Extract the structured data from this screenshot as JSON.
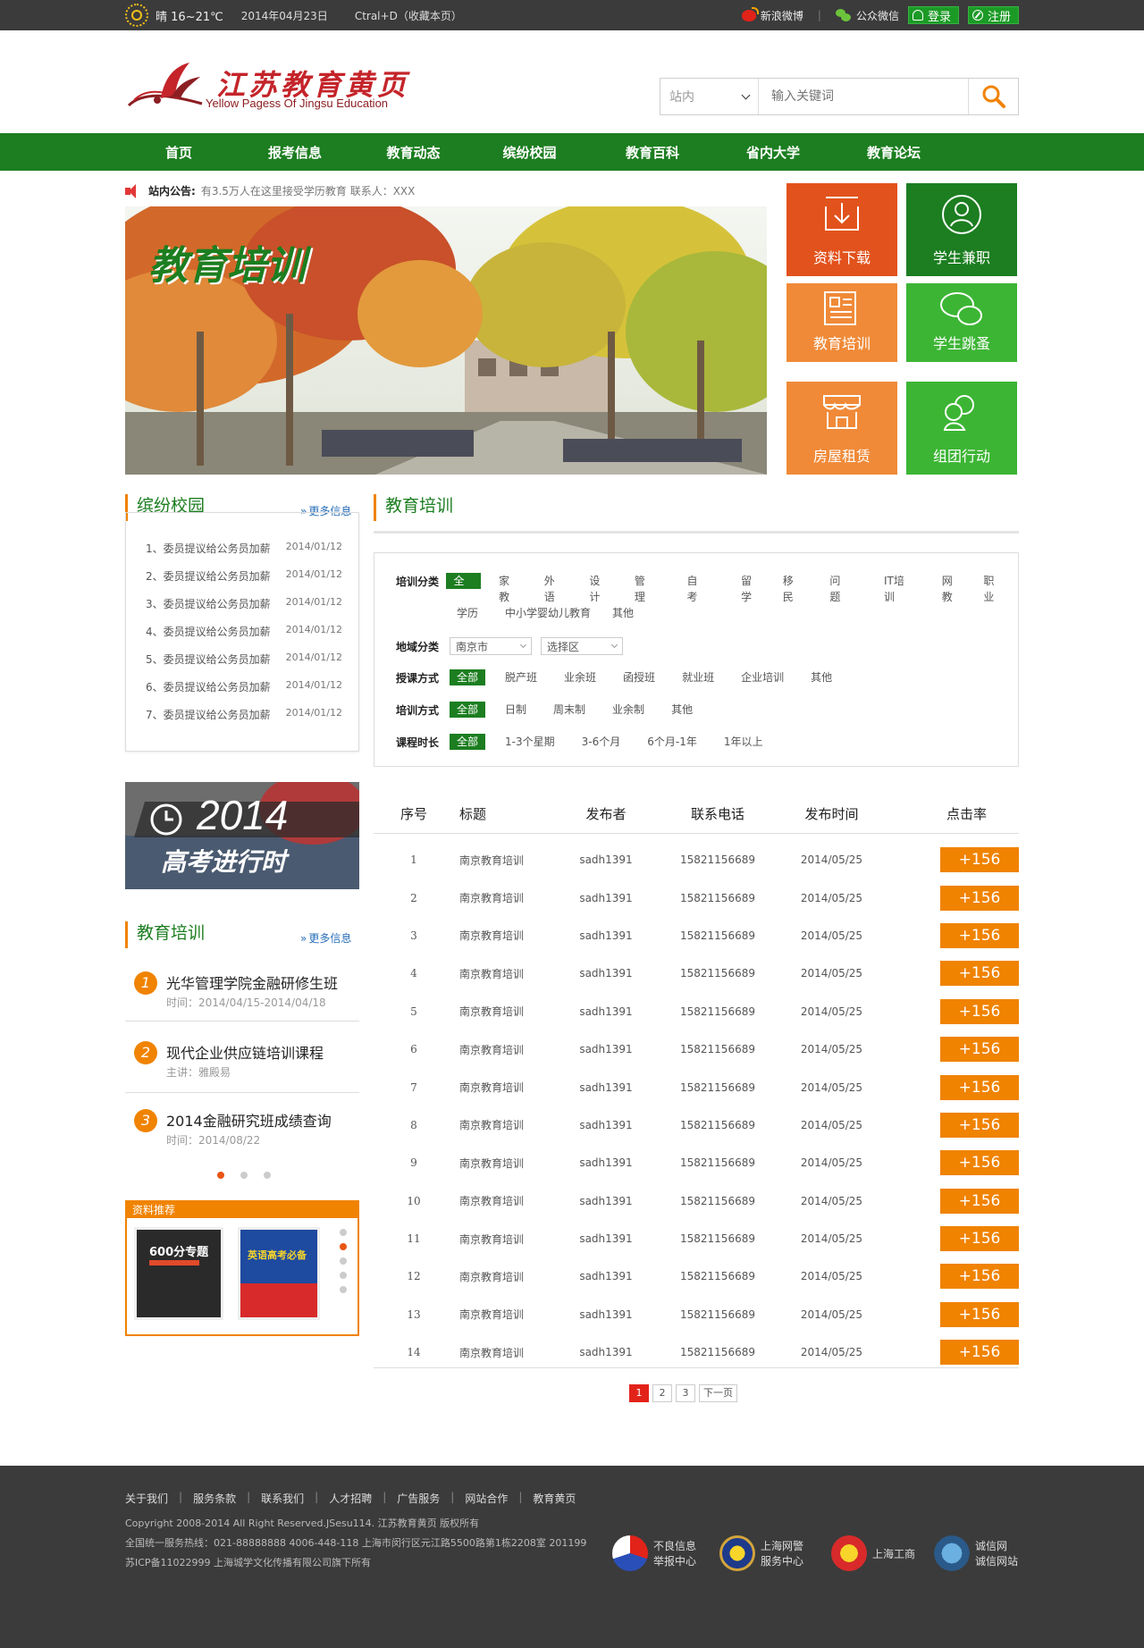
{
  "topbar": {
    "weather": "晴 16~21℃",
    "date": "2014年04月23日",
    "bookmark": "Ctral+D（收藏本页）",
    "weibo": "新浪微博",
    "wechat": "公众微信",
    "login": "登录",
    "register": "注册"
  },
  "logo": {
    "cn": "江苏教育黄页",
    "en": "Yellow Pagess Of Jingsu Education"
  },
  "search": {
    "scope": "站内",
    "placeholder": "输入关键词"
  },
  "nav": [
    "首页",
    "报考信息",
    "教育动态",
    "缤纷校园",
    "教育百科",
    "省内大学",
    "教育论坛"
  ],
  "notice": {
    "label": "站内公告:",
    "text": "有3.5万人在这里接受学历教育   联系人：XXX"
  },
  "banner": {
    "title": "教育培训"
  },
  "tiles": [
    {
      "label": "资料下载",
      "icon": "download-icon",
      "color": "#e2521c"
    },
    {
      "label": "学生兼职",
      "icon": "user-icon",
      "color": "#1c7e20"
    },
    {
      "label": "教育培训",
      "icon": "document-icon",
      "color": "#f08a38"
    },
    {
      "label": "学生跳蚤",
      "icon": "chat-icon",
      "color": "#3cb534"
    },
    {
      "label": "房屋租赁",
      "icon": "shop-icon",
      "color": "#f08a38"
    },
    {
      "label": "组团行动",
      "icon": "group-icon",
      "color": "#3cb534"
    }
  ],
  "campus": {
    "title": "缤纷校园",
    "more": "更多信息",
    "items": [
      {
        "text": "1、委员提议给公务员加薪",
        "date": "2014/01/12"
      },
      {
        "text": "2、委员提议给公务员加薪",
        "date": "2014/01/12"
      },
      {
        "text": "3、委员提议给公务员加薪",
        "date": "2014/01/12"
      },
      {
        "text": "4、委员提议给公务员加薪",
        "date": "2014/01/12"
      },
      {
        "text": "5、委员提议给公务员加薪",
        "date": "2014/01/12"
      },
      {
        "text": "6、委员提议给公务员加薪",
        "date": "2014/01/12"
      },
      {
        "text": "7、委员提议给公务员加薪",
        "date": "2014/01/12"
      }
    ]
  },
  "gaokao": {
    "year": "2014",
    "text": "高考进行时"
  },
  "training_side": {
    "title": "教育培训",
    "more": "更多信息",
    "items": [
      {
        "num": "1",
        "title": "光华管理学院金融研修生班",
        "sub": "时间：2014/04/15-2014/04/18"
      },
      {
        "num": "2",
        "title": "现代企业供应链培训课程",
        "sub": "主讲：雅殿易"
      },
      {
        "num": "3",
        "title": "2014金融研究班成绩查询",
        "sub": "时间：2014/08/22"
      }
    ]
  },
  "books": {
    "title": "资料推荐",
    "book1": "600分专题",
    "book2": "英语高考必备"
  },
  "training_main": {
    "title": "教育培训"
  },
  "filters": {
    "category_label": "培训分类",
    "category_opts": [
      "全部",
      "家教",
      "外语",
      "设计",
      "管理",
      "自考",
      "留学",
      "移民",
      "问题",
      "IT培训",
      "网教",
      "职业"
    ],
    "category_opts2": [
      "学历",
      "中小学婴幼儿教育",
      "其他"
    ],
    "region_label": "地域分类",
    "region_city": "南京市",
    "region_district": "选择区",
    "teach_label": "授课方式",
    "teach_opts": [
      "全部",
      "脱产班",
      "业余班",
      "函授班",
      "就业班",
      "企业培训",
      "其他"
    ],
    "mode_label": "培训方式",
    "mode_opts": [
      "全部",
      "日制",
      "周末制",
      "业余制",
      "其他"
    ],
    "duration_label": "课程时长",
    "duration_opts": [
      "全部",
      "1-3个星期",
      "3-6个月",
      "6个月-1年",
      "1年以上"
    ]
  },
  "table": {
    "headers": [
      "序号",
      "标题",
      "发布者",
      "联系电话",
      "发布时间",
      "点击率"
    ],
    "rows": [
      {
        "no": "1",
        "title": "南京教育培训",
        "author": "sadh1391",
        "phone": "15821156689",
        "date": "2014/05/25",
        "hits": "+156"
      },
      {
        "no": "2",
        "title": "南京教育培训",
        "author": "sadh1391",
        "phone": "15821156689",
        "date": "2014/05/25",
        "hits": "+156"
      },
      {
        "no": "3",
        "title": "南京教育培训",
        "author": "sadh1391",
        "phone": "15821156689",
        "date": "2014/05/25",
        "hits": "+156"
      },
      {
        "no": "4",
        "title": "南京教育培训",
        "author": "sadh1391",
        "phone": "15821156689",
        "date": "2014/05/25",
        "hits": "+156"
      },
      {
        "no": "5",
        "title": "南京教育培训",
        "author": "sadh1391",
        "phone": "15821156689",
        "date": "2014/05/25",
        "hits": "+156"
      },
      {
        "no": "6",
        "title": "南京教育培训",
        "author": "sadh1391",
        "phone": "15821156689",
        "date": "2014/05/25",
        "hits": "+156"
      },
      {
        "no": "7",
        "title": "南京教育培训",
        "author": "sadh1391",
        "phone": "15821156689",
        "date": "2014/05/25",
        "hits": "+156"
      },
      {
        "no": "8",
        "title": "南京教育培训",
        "author": "sadh1391",
        "phone": "15821156689",
        "date": "2014/05/25",
        "hits": "+156"
      },
      {
        "no": "9",
        "title": "南京教育培训",
        "author": "sadh1391",
        "phone": "15821156689",
        "date": "2014/05/25",
        "hits": "+156"
      },
      {
        "no": "10",
        "title": "南京教育培训",
        "author": "sadh1391",
        "phone": "15821156689",
        "date": "2014/05/25",
        "hits": "+156"
      },
      {
        "no": "11",
        "title": "南京教育培训",
        "author": "sadh1391",
        "phone": "15821156689",
        "date": "2014/05/25",
        "hits": "+156"
      },
      {
        "no": "12",
        "title": "南京教育培训",
        "author": "sadh1391",
        "phone": "15821156689",
        "date": "2014/05/25",
        "hits": "+156"
      },
      {
        "no": "13",
        "title": "南京教育培训",
        "author": "sadh1391",
        "phone": "15821156689",
        "date": "2014/05/25",
        "hits": "+156"
      },
      {
        "no": "14",
        "title": "南京教育培训",
        "author": "sadh1391",
        "phone": "15821156689",
        "date": "2014/05/25",
        "hits": "+156"
      }
    ]
  },
  "pager": {
    "pages": [
      "1",
      "2",
      "3"
    ],
    "next": "下一页"
  },
  "footer": {
    "links": [
      "关于我们",
      "服务条款",
      "联系我们",
      "人才招聘",
      "广告服务",
      "网站合作",
      "教育黄页"
    ],
    "copyright": "Copyright 2008-2014 All Right Reserved.JSesu114. 江苏教育黄页 版权所有",
    "hotline": "全国统一服务热线：021-88888888 4006-448-118   上海市闵行区元江路5500路第1栋2208室 201199",
    "icp": "苏ICP备11022999   上海城学文化传播有限公司旗下所有",
    "badges": [
      {
        "l1": "不良信息",
        "l2": "举报中心"
      },
      {
        "l1": "上海网警",
        "l2": "服务中心"
      },
      {
        "l1": "上海工商",
        "l2": ""
      },
      {
        "l1": "诚信网",
        "l2": "诚信网站"
      }
    ]
  }
}
